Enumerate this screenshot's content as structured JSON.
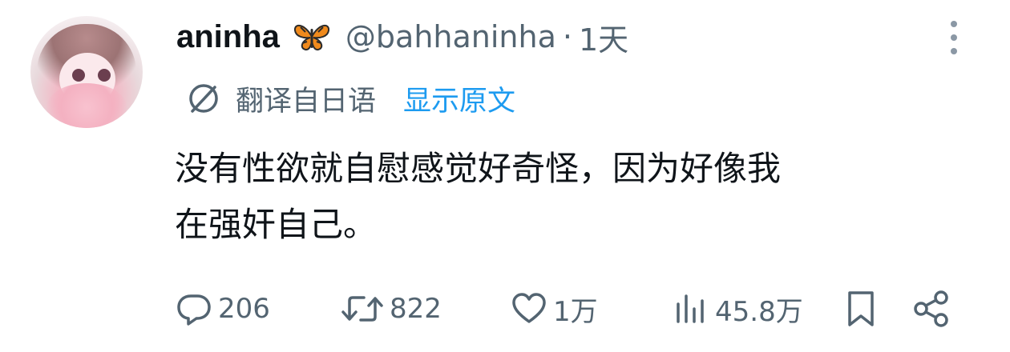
{
  "tweet": {
    "display_name": "aninha",
    "name_emoji": "butterfly-emoji",
    "handle": "@bahhaninha",
    "separator": "·",
    "time": "1天",
    "translate_label": "翻译自日语",
    "show_original_label": "显示原文",
    "text_line1": "没有性欲就自慰感觉好奇怪，因为好像我",
    "text_line2": "在强奸自己。"
  },
  "actions": {
    "reply_count": "206",
    "retweet_count": "822",
    "like_count": "1万",
    "views_count": "45.8万"
  },
  "colors": {
    "text_primary": "#0f1419",
    "text_secondary": "#536471",
    "link": "#1d9bf0"
  }
}
